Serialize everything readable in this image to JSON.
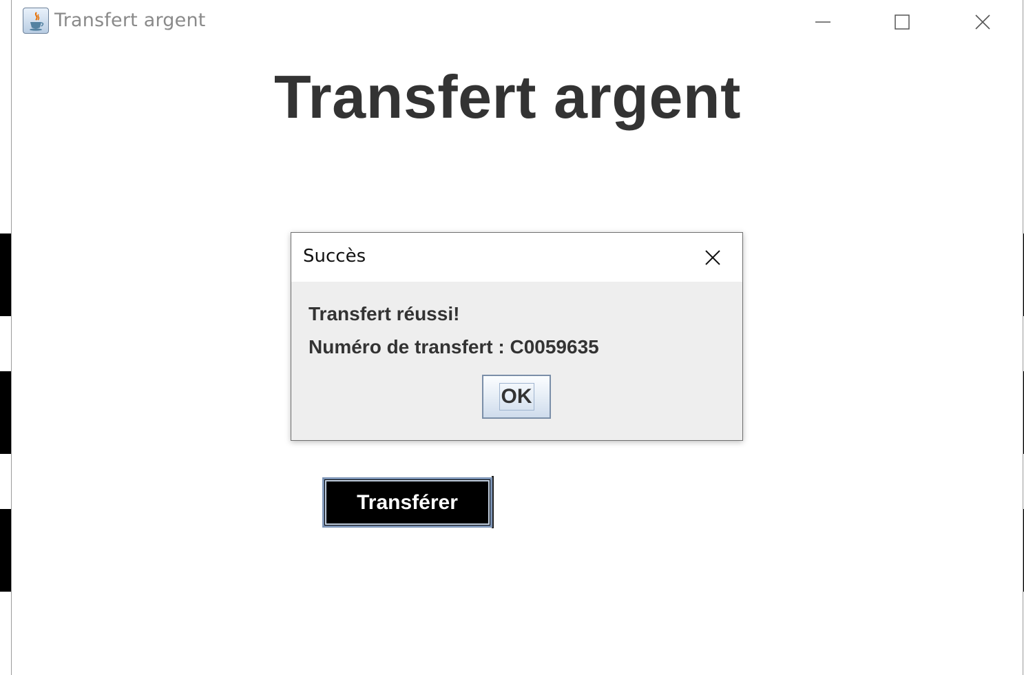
{
  "window": {
    "title": "Transfert argent",
    "icon": "java-cup-icon",
    "controls": [
      "minimize-icon",
      "maximize-icon",
      "close-icon"
    ]
  },
  "main": {
    "heading": "Transfert argent",
    "transfer_button_label": "Transférer"
  },
  "dialog": {
    "title": "Succès",
    "message_line1": "Transfert réussi!",
    "message_line2": "Numéro de transfert : C0059635",
    "ok_label": "OK"
  },
  "colors": {
    "heading_text": "#333333",
    "button_bg": "#000000",
    "dialog_bg": "#eeeeee"
  }
}
